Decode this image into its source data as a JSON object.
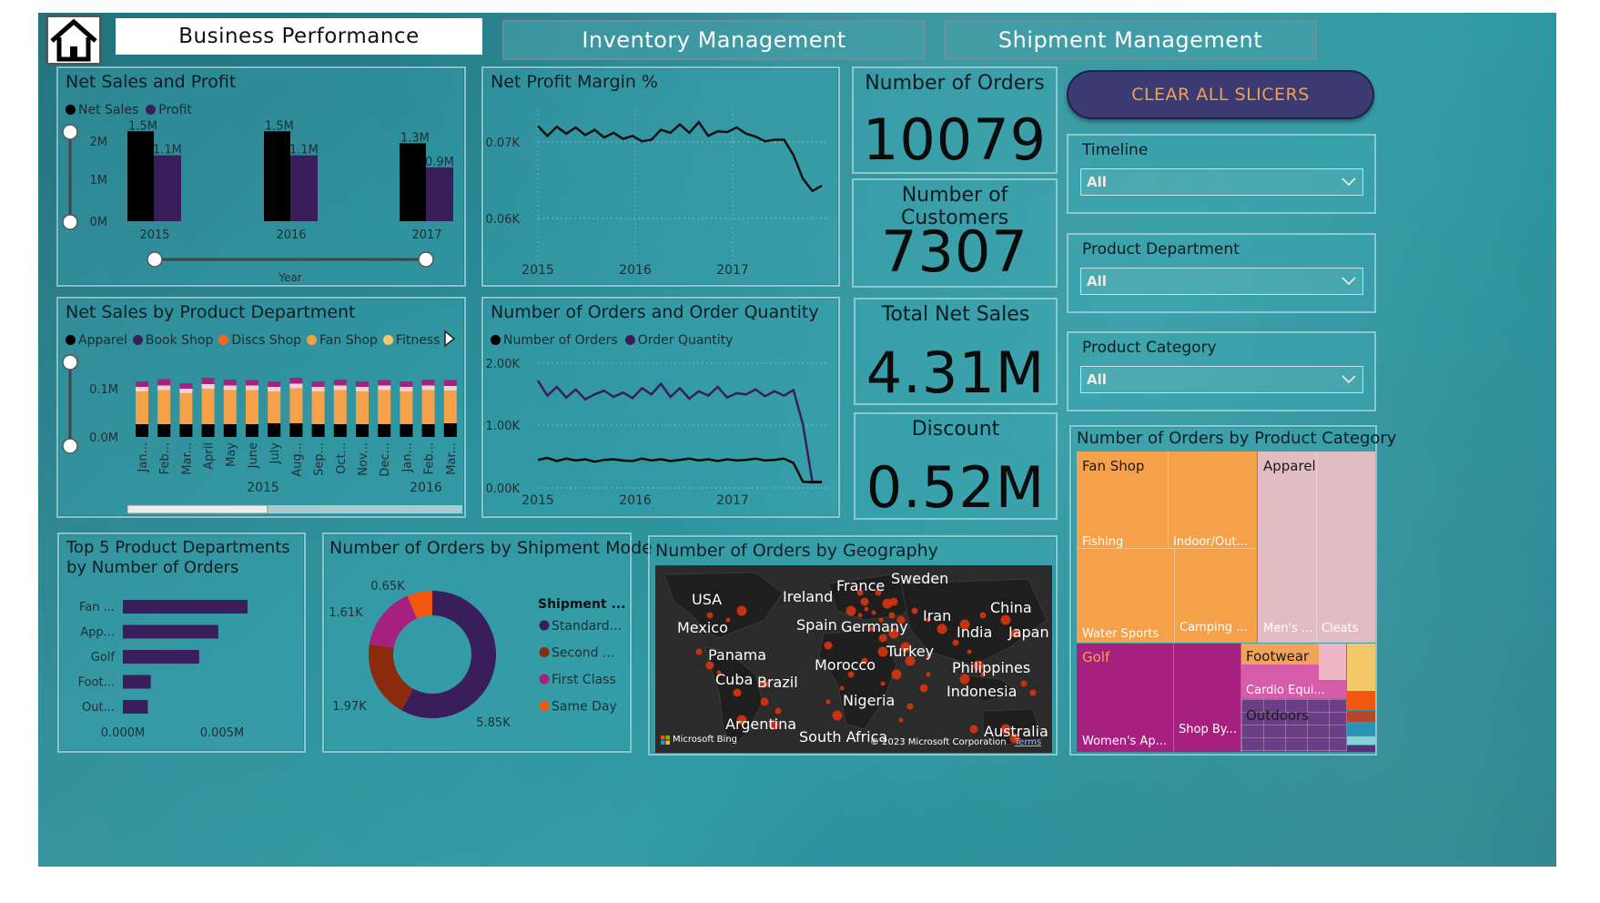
{
  "nav": {
    "home_icon": "home-icon",
    "business": "Business Performance",
    "inventory": "Inventory Management",
    "shipment": "Shipment Management",
    "clear": "CLEAR ALL SLICERS"
  },
  "kpis": {
    "orders": {
      "label": "Number of Orders",
      "value": "10079"
    },
    "customers": {
      "label": "Number of Customers",
      "value": "7307"
    },
    "net_sales": {
      "label": "Total Net Sales",
      "value": "4.31M"
    },
    "discount": {
      "label": "Discount",
      "value": "0.52M"
    }
  },
  "slicers": [
    {
      "label": "Timeline",
      "value": "All"
    },
    {
      "label": "Product Department",
      "value": "All"
    },
    {
      "label": "Product Category",
      "value": "All"
    }
  ],
  "colors": {
    "net_sales": "#000000",
    "profit": "#3a1e5c",
    "apparel": "#000000",
    "book_shop": "#3a1e5c",
    "discs_shop": "#f26b1f",
    "fan_shop": "#f4a14a",
    "fitness": "#f3c86a"
  },
  "chart_data": [
    {
      "id": "net-sales-profit",
      "type": "bar",
      "title": "Net Sales and Profit",
      "categories": [
        "2015",
        "2016",
        "2017"
      ],
      "series": [
        {
          "name": "Net Sales",
          "values": [
            1.5,
            1.5,
            1.3
          ],
          "labels": [
            "1.5M",
            "1.5M",
            "1.3M"
          ]
        },
        {
          "name": "Profit",
          "values": [
            1.1,
            1.1,
            0.9
          ],
          "labels": [
            "1.1M",
            "1.1M",
            "0.9M"
          ]
        }
      ],
      "yticks": [
        "2M",
        "1M",
        "0M"
      ],
      "ylim": [
        0,
        2
      ],
      "xlabel": "Year"
    },
    {
      "id": "net-profit-margin",
      "type": "line",
      "title": "Net Profit Margin %",
      "yticks": [
        "0.07K",
        "0.06K"
      ],
      "xticks": [
        "2015",
        "2016",
        "2017"
      ],
      "ylim": [
        0.055,
        0.075
      ],
      "values": [
        0.0721,
        0.0708,
        0.072,
        0.0711,
        0.0719,
        0.0709,
        0.0716,
        0.0706,
        0.0712,
        0.0704,
        0.0708,
        0.0701,
        0.0703,
        0.0716,
        0.0712,
        0.0723,
        0.0712,
        0.0726,
        0.0708,
        0.0714,
        0.0713,
        0.0719,
        0.0711,
        0.0707,
        0.0701,
        0.0703,
        0.0703,
        0.0683,
        0.0652,
        0.0636,
        0.0643
      ]
    },
    {
      "id": "sales-by-department",
      "type": "bar",
      "title": "Net Sales by Product Department",
      "stacked": true,
      "legend": [
        "Apparel",
        "Book Shop",
        "Discs Shop",
        "Fan Shop",
        "Fitness"
      ],
      "categories": [
        "Jan...",
        "Feb...",
        "Mar...",
        "April",
        "May",
        "June",
        "July",
        "Aug...",
        "Sep...",
        "Oct...",
        "Nov...",
        "Dec...",
        "Jan...",
        "Feb...",
        "Mar..."
      ],
      "year_labels": [
        "2015",
        "2016"
      ],
      "yticks": [
        "0.1M",
        "0.0M"
      ],
      "series": [
        {
          "name": "Apparel",
          "values": [
            0.028,
            0.028,
            0.028,
            0.028,
            0.028,
            0.028,
            0.03,
            0.03,
            0.028,
            0.028,
            0.028,
            0.028,
            0.028,
            0.028,
            0.03
          ]
        },
        {
          "name": "Fan Shop",
          "values": [
            0.072,
            0.075,
            0.068,
            0.078,
            0.075,
            0.075,
            0.07,
            0.077,
            0.072,
            0.075,
            0.072,
            0.075,
            0.072,
            0.075,
            0.072
          ]
        },
        {
          "name": "Fitness",
          "values": [
            0.01,
            0.01,
            0.01,
            0.01,
            0.01,
            0.01,
            0.01,
            0.01,
            0.01,
            0.01,
            0.01,
            0.01,
            0.01,
            0.01,
            0.01
          ]
        },
        {
          "name": "Book Shop",
          "values": [
            0.012,
            0.014,
            0.012,
            0.014,
            0.013,
            0.012,
            0.012,
            0.013,
            0.012,
            0.013,
            0.012,
            0.012,
            0.012,
            0.013,
            0.013
          ]
        }
      ]
    },
    {
      "id": "orders-and-quantity",
      "type": "line",
      "title": "Number of Orders and Order Quantity",
      "legend": [
        "Number of Orders",
        "Order Quantity"
      ],
      "yticks": [
        "2.00K",
        "1.00K",
        "0.00K"
      ],
      "xticks": [
        "2015",
        "2016",
        "2017"
      ],
      "ylim": [
        0,
        2
      ],
      "series": [
        {
          "name": "Order Quantity",
          "values": [
            1.72,
            1.48,
            1.62,
            1.45,
            1.58,
            1.42,
            1.5,
            1.56,
            1.46,
            1.53,
            1.44,
            1.6,
            1.5,
            1.67,
            1.46,
            1.6,
            1.43,
            1.55,
            1.48,
            1.62,
            1.45,
            1.52,
            1.5,
            1.58,
            1.47,
            1.55,
            1.48,
            1.57,
            1.02,
            0.1,
            0.1
          ]
        },
        {
          "name": "Number of Orders",
          "values": [
            0.45,
            0.48,
            0.43,
            0.47,
            0.44,
            0.46,
            0.42,
            0.45,
            0.46,
            0.44,
            0.43,
            0.47,
            0.44,
            0.46,
            0.43,
            0.45,
            0.47,
            0.44,
            0.46,
            0.43,
            0.46,
            0.44,
            0.45,
            0.47,
            0.44,
            0.45,
            0.47,
            0.4,
            0.1,
            0.09,
            0.09
          ]
        }
      ]
    },
    {
      "id": "top5-departments",
      "type": "bar",
      "orientation": "horizontal",
      "title_line1": "Top 5 Product Departments",
      "title_line2": "by Number of Orders",
      "categories": [
        "Fan ...",
        "App...",
        "Golf",
        "Foot...",
        "Out..."
      ],
      "values": [
        0.0085,
        0.0065,
        0.0052,
        0.0019,
        0.0017
      ],
      "xticks": [
        "0.000M",
        "0.005M"
      ],
      "xlim": [
        0,
        0.0097
      ]
    },
    {
      "id": "shipment-mode",
      "type": "pie",
      "donut": true,
      "title": "Number of Orders by Shipment Mode",
      "legend_title": "Shipment ...",
      "labels": [
        "Standard...",
        "Second ...",
        "First Class",
        "Same Day"
      ],
      "values": [
        5.85,
        1.97,
        1.61,
        0.65
      ],
      "value_labels": [
        "5.85K",
        "1.97K",
        "1.61K",
        "0.65K"
      ],
      "colors": [
        "#3a1e5c",
        "#8c2a0c",
        "#a6207e",
        "#f2570e"
      ]
    },
    {
      "id": "category-treemap",
      "type": "table",
      "title": "Number of Orders by Product Category",
      "labels": [
        "Fan Shop",
        "Apparel",
        "Fishing",
        "Indoor/Out...",
        "Water Sports",
        "Camping ...",
        "Men's ...",
        "Cleats",
        "Golf",
        "Women's Ap...",
        "Shop By...",
        "Footwear",
        "Cardio Equi...",
        "Outdoors"
      ]
    }
  ],
  "geo": {
    "title": "Number of Orders by Geography",
    "countries": [
      "USA",
      "Ireland",
      "France",
      "Sweden",
      "China",
      "Mexico",
      "Spain",
      "Germany",
      "Iran",
      "India",
      "Japan",
      "Turkey",
      "Panama",
      "Morocco",
      "Philippines",
      "Cuba",
      "Brazil",
      "Indonesia",
      "Nigeria",
      "Argentina",
      "South Africa",
      "Australia"
    ],
    "bing": "Microsoft Bing",
    "copyright": "© 2023 Microsoft Corporation",
    "terms": "Terms"
  }
}
